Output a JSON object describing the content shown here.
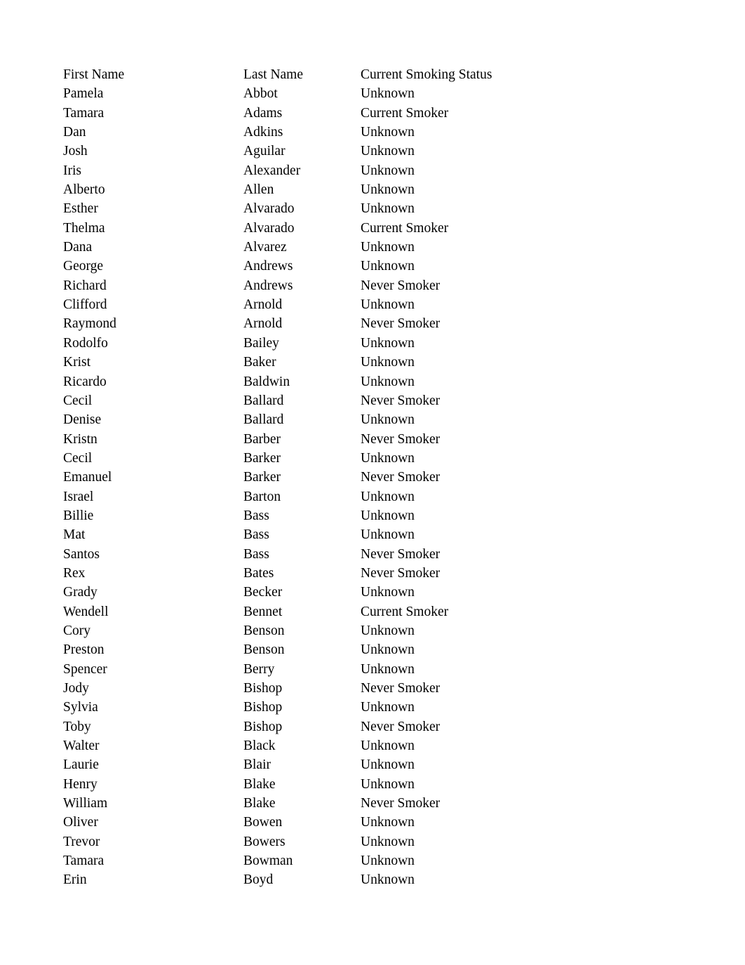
{
  "document": {
    "type": "text-document",
    "page_background": "#ffffff",
    "text_color": "#000000",
    "columns": [
      {
        "key": "first_name",
        "header": "First Name"
      },
      {
        "key": "last_name",
        "header": "Last Name"
      },
      {
        "key": "smoking_status",
        "header": "Current Smoking Status"
      }
    ],
    "headers": {
      "first_name": "First Name",
      "last_name": "Last Name",
      "smoking_status": "Current Smoking Status"
    },
    "row_count": 42,
    "rows": [
      {
        "first_name": "Pamela",
        "last_name": "Abbot",
        "smoking_status": "Unknown"
      },
      {
        "first_name": "Tamara",
        "last_name": "Adams",
        "smoking_status": "Current Smoker"
      },
      {
        "first_name": "Dan",
        "last_name": "Adkins",
        "smoking_status": "Unknown"
      },
      {
        "first_name": "Josh",
        "last_name": "Aguilar",
        "smoking_status": "Unknown"
      },
      {
        "first_name": "Iris",
        "last_name": "Alexander",
        "smoking_status": "Unknown"
      },
      {
        "first_name": "Alberto",
        "last_name": "Allen",
        "smoking_status": "Unknown"
      },
      {
        "first_name": "Esther",
        "last_name": "Alvarado",
        "smoking_status": "Unknown"
      },
      {
        "first_name": "Thelma",
        "last_name": "Alvarado",
        "smoking_status": "Current Smoker"
      },
      {
        "first_name": "Dana",
        "last_name": "Alvarez",
        "smoking_status": "Unknown"
      },
      {
        "first_name": "George",
        "last_name": "Andrews",
        "smoking_status": "Unknown"
      },
      {
        "first_name": "Richard",
        "last_name": "Andrews",
        "smoking_status": "Never Smoker"
      },
      {
        "first_name": "Clifford",
        "last_name": "Arnold",
        "smoking_status": "Unknown"
      },
      {
        "first_name": "Raymond",
        "last_name": "Arnold",
        "smoking_status": "Never Smoker"
      },
      {
        "first_name": "Rodolfo",
        "last_name": "Bailey",
        "smoking_status": "Unknown"
      },
      {
        "first_name": "Krist",
        "last_name": "Baker",
        "smoking_status": "Unknown"
      },
      {
        "first_name": "Ricardo",
        "last_name": "Baldwin",
        "smoking_status": "Unknown"
      },
      {
        "first_name": "Cecil",
        "last_name": "Ballard",
        "smoking_status": "Never Smoker"
      },
      {
        "first_name": "Denise",
        "last_name": "Ballard",
        "smoking_status": "Unknown"
      },
      {
        "first_name": "Kristn",
        "last_name": "Barber",
        "smoking_status": "Never Smoker"
      },
      {
        "first_name": "Cecil",
        "last_name": "Barker",
        "smoking_status": "Unknown"
      },
      {
        "first_name": "Emanuel",
        "last_name": "Barker",
        "smoking_status": "Never Smoker"
      },
      {
        "first_name": "Israel",
        "last_name": "Barton",
        "smoking_status": "Unknown"
      },
      {
        "first_name": "Billie",
        "last_name": "Bass",
        "smoking_status": "Unknown"
      },
      {
        "first_name": "Mat",
        "last_name": "Bass",
        "smoking_status": "Unknown"
      },
      {
        "first_name": "Santos",
        "last_name": "Bass",
        "smoking_status": "Never Smoker"
      },
      {
        "first_name": "Rex",
        "last_name": "Bates",
        "smoking_status": "Never Smoker"
      },
      {
        "first_name": "Grady",
        "last_name": "Becker",
        "smoking_status": "Unknown"
      },
      {
        "first_name": "Wendell",
        "last_name": "Bennet",
        "smoking_status": "Current Smoker"
      },
      {
        "first_name": "Cory",
        "last_name": "Benson",
        "smoking_status": "Unknown"
      },
      {
        "first_name": "Preston",
        "last_name": "Benson",
        "smoking_status": "Unknown"
      },
      {
        "first_name": "Spencer",
        "last_name": "Berry",
        "smoking_status": "Unknown"
      },
      {
        "first_name": "Jody",
        "last_name": "Bishop",
        "smoking_status": "Never Smoker"
      },
      {
        "first_name": "Sylvia",
        "last_name": "Bishop",
        "smoking_status": "Unknown"
      },
      {
        "first_name": "Toby",
        "last_name": "Bishop",
        "smoking_status": "Never Smoker"
      },
      {
        "first_name": "Walter",
        "last_name": "Black",
        "smoking_status": "Unknown"
      },
      {
        "first_name": "Laurie",
        "last_name": "Blair",
        "smoking_status": "Unknown"
      },
      {
        "first_name": "Henry",
        "last_name": "Blake",
        "smoking_status": "Unknown"
      },
      {
        "first_name": "William",
        "last_name": "Blake",
        "smoking_status": "Never Smoker"
      },
      {
        "first_name": "Oliver",
        "last_name": "Bowen",
        "smoking_status": "Unknown"
      },
      {
        "first_name": "Trevor",
        "last_name": "Bowers",
        "smoking_status": "Unknown"
      },
      {
        "first_name": "Tamara",
        "last_name": "Bowman",
        "smoking_status": "Unknown"
      },
      {
        "first_name": "Erin",
        "last_name": "Boyd",
        "smoking_status": "Unknown"
      }
    ]
  }
}
